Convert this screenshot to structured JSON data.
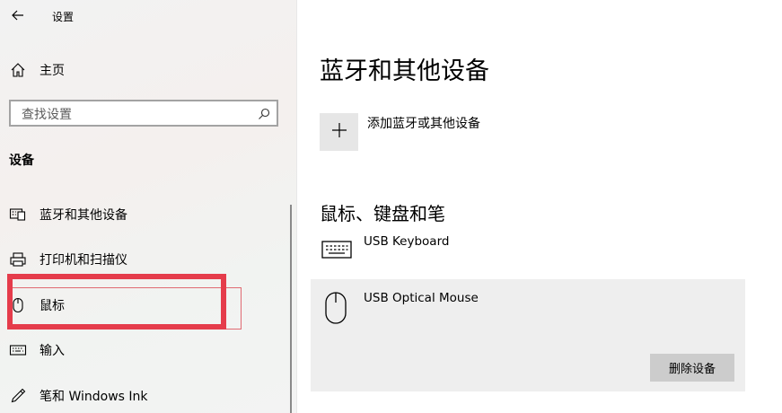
{
  "window": {
    "title": "设置"
  },
  "sidebar": {
    "home_label": "主页",
    "search_placeholder": "查找设置",
    "section_title": "设备",
    "items": [
      {
        "label": "蓝牙和其他设备",
        "icon": "bluetooth-devices-icon"
      },
      {
        "label": "打印机和扫描仪",
        "icon": "printer-icon"
      },
      {
        "label": "鼠标",
        "icon": "mouse-icon"
      },
      {
        "label": "输入",
        "icon": "keyboard-icon"
      },
      {
        "label": "笔和 Windows Ink",
        "icon": "pen-icon"
      }
    ],
    "highlighted_item": "鼠标",
    "highlight_color": "#e53c4b"
  },
  "main": {
    "title": "蓝牙和其他设备",
    "add_device_label": "添加蓝牙或其他设备",
    "section_title": "鼠标、键盘和笔",
    "devices": [
      {
        "name": "USB Keyboard",
        "icon": "keyboard-icon"
      },
      {
        "name": "USB Optical Mouse",
        "icon": "mouse-icon",
        "selected": true,
        "action_label": "删除设备"
      }
    ]
  }
}
